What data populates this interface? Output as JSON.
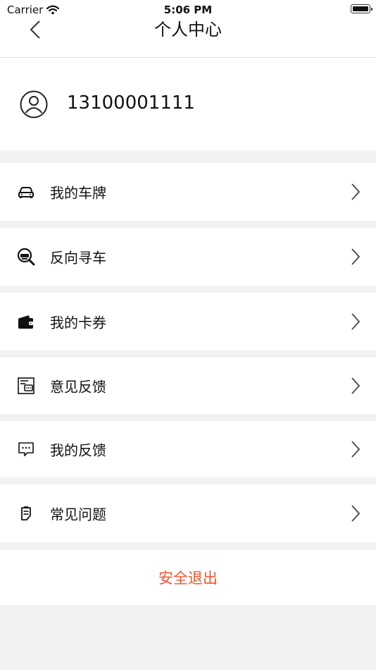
{
  "status_bar": {
    "carrier": "Carrier",
    "time": "5:06 PM"
  },
  "nav": {
    "title": "个人中心",
    "back_icon": "chevron-left-icon"
  },
  "profile": {
    "phone": "13100001111",
    "avatar_icon": "user-circle-icon"
  },
  "menu": [
    {
      "label": "我的车牌",
      "icon": "car-icon"
    },
    {
      "label": "反向寻车",
      "icon": "car-search-icon"
    },
    {
      "label": "我的卡券",
      "icon": "wallet-icon"
    },
    {
      "label": "意见反馈",
      "icon": "feedback-form-icon"
    },
    {
      "label": "我的反馈",
      "icon": "chat-bubble-icon"
    },
    {
      "label": "常见问题",
      "icon": "faq-icon"
    }
  ],
  "logout": {
    "label": "安全退出",
    "color": "#f0542f"
  },
  "colors": {
    "background": "#f2f2f2",
    "card": "#ffffff",
    "text": "#111111",
    "chevron": "#555555"
  }
}
